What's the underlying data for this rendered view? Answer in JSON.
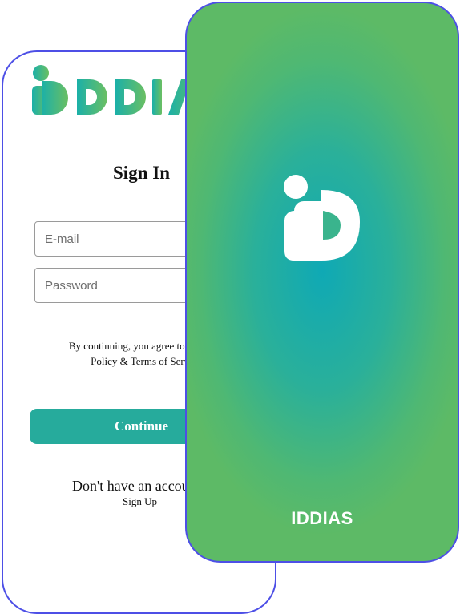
{
  "colors": {
    "frame_border": "#4d4fe6",
    "primary_button": "#26ab9c",
    "brand_teal": "#1bb0a8",
    "brand_green": "#6bbf62"
  },
  "signin_screen": {
    "logo_text": "IDDIAS",
    "title": "Sign In",
    "email_placeholder": "E-mail",
    "password_placeholder": "Password",
    "terms_line1": "By continuing, you agree to accept",
    "terms_line2": "Policy & Terms of Servi",
    "continue_label": "Continue",
    "no_account_text": "Don't have an accou",
    "signup_label": "Sign Up"
  },
  "splash_screen": {
    "logo_icon": "iddias-mark-icon",
    "brand_name": "IDDIAS"
  }
}
